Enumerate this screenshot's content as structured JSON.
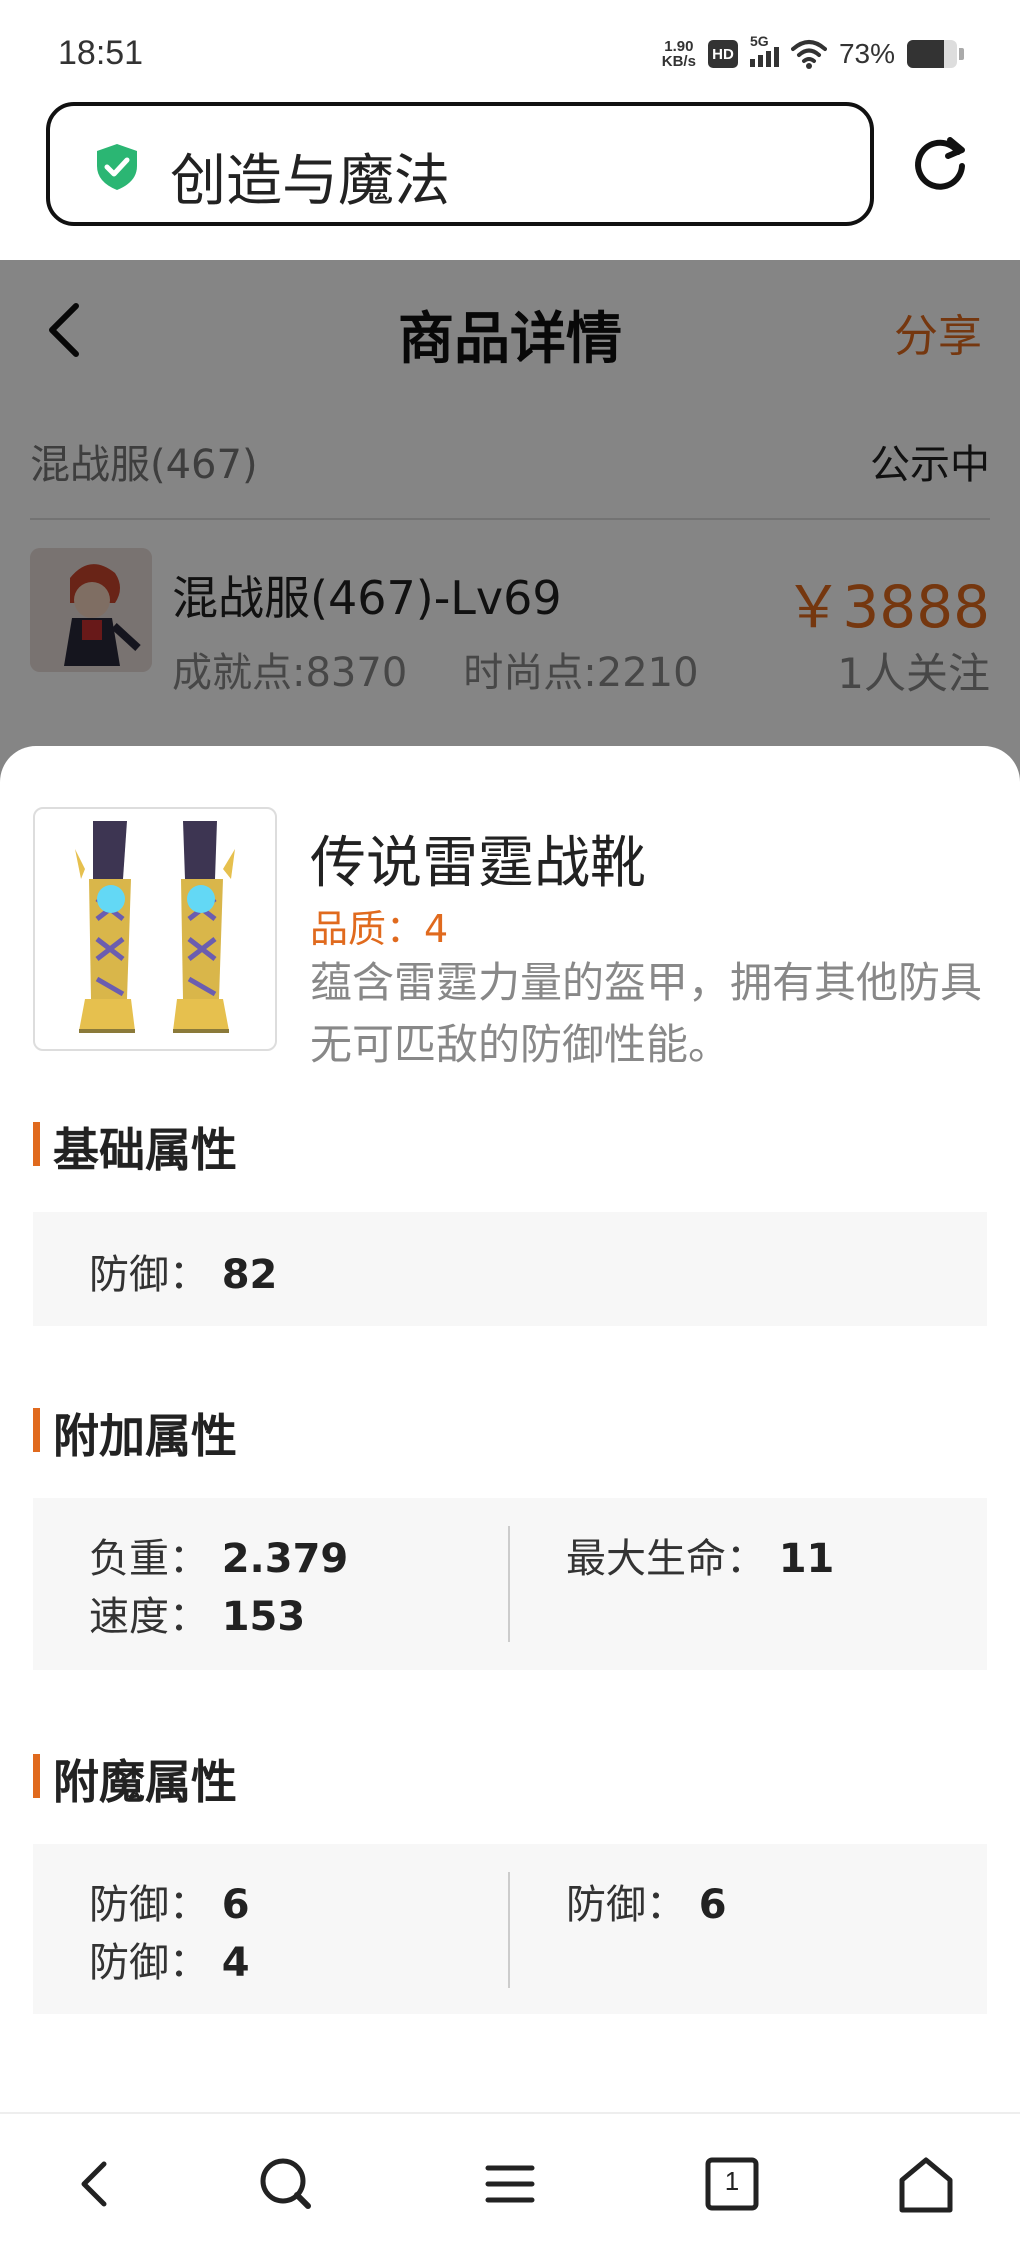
{
  "status_bar": {
    "time": "18:51",
    "net_speed_value": "1.90",
    "net_speed_unit": "KB/s",
    "hd_label": "HD",
    "network_label": "5G",
    "battery_percent": "73%",
    "battery_level": 0.73
  },
  "browser": {
    "url_text": "创造与魔法",
    "secure_color": "#2bb673"
  },
  "page": {
    "title": "商品详情",
    "share_label": "分享",
    "server_name": "混战服(467)",
    "status": "公示中",
    "listing": {
      "title": "混战服(467)-Lv69",
      "achievement": "成就点:8370",
      "fashion": "时尚点:2210",
      "price": "￥3888",
      "followers": "1人关注"
    }
  },
  "item": {
    "name": "传说雷霆战靴",
    "quality": "品质：4",
    "description": "蕴含雷霆力量的盔甲，拥有其他防具无可匹敌的防御性能。"
  },
  "sections": {
    "base": {
      "title": "基础属性",
      "attrs": [
        {
          "label": "防御：",
          "value": "82"
        }
      ]
    },
    "extra": {
      "title": "附加属性",
      "left": [
        {
          "label": "负重：",
          "value": "2.379"
        },
        {
          "label": "速度：",
          "value": "153"
        }
      ],
      "right": [
        {
          "label": "最大生命：",
          "value": "11"
        }
      ]
    },
    "enchant": {
      "title": "附魔属性",
      "left": [
        {
          "label": "防御：",
          "value": "6"
        },
        {
          "label": "防御：",
          "value": "4"
        }
      ],
      "right": [
        {
          "label": "防御：",
          "value": "6"
        }
      ]
    }
  },
  "bottom_nav": {
    "tab_count": "1",
    "icons": [
      "back-icon",
      "search-icon",
      "menu-icon",
      "tabs-icon",
      "home-icon"
    ]
  },
  "colors": {
    "accent": "#e06a1e",
    "overlay": "rgba(0,0,0,0.48)"
  }
}
